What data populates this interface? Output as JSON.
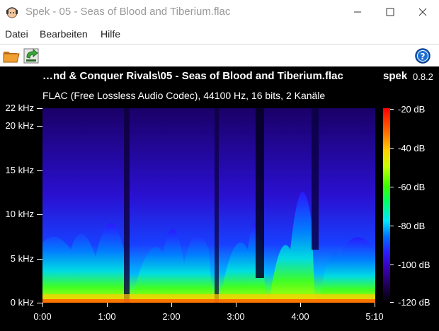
{
  "window": {
    "title": "Spek - 05 - Seas of Blood and Tiberium.flac"
  },
  "menu": {
    "items": [
      {
        "label": "Datei"
      },
      {
        "label": "Bearbeiten"
      },
      {
        "label": "Hilfe"
      }
    ]
  },
  "toolbar": {
    "open_icon": "folder-open-icon",
    "save_icon": "save-icon",
    "help_icon": "help-icon"
  },
  "viewer": {
    "file_title": "…nd & Conquer Rivals\\05 - Seas of Blood and Tiberium.flac",
    "brand": "spek",
    "version": "0.8.2",
    "file_info": "FLAC (Free Lossless Audio Codec), 44100 Hz, 16 bits, 2 Kanäle",
    "freq_labels": [
      "22 kHz",
      "20 kHz",
      "15 kHz",
      "10 kHz",
      "5 kHz",
      "0 kHz"
    ],
    "time_labels": [
      "0:00",
      "1:00",
      "2:00",
      "3:00",
      "4:00",
      "5:10"
    ],
    "db_labels": [
      "-20 dB",
      "-40 dB",
      "-60 dB",
      "-80 dB",
      "-100 dB",
      "-120 dB"
    ]
  },
  "colors": {
    "background": "#000000",
    "text": "#ffffff"
  }
}
